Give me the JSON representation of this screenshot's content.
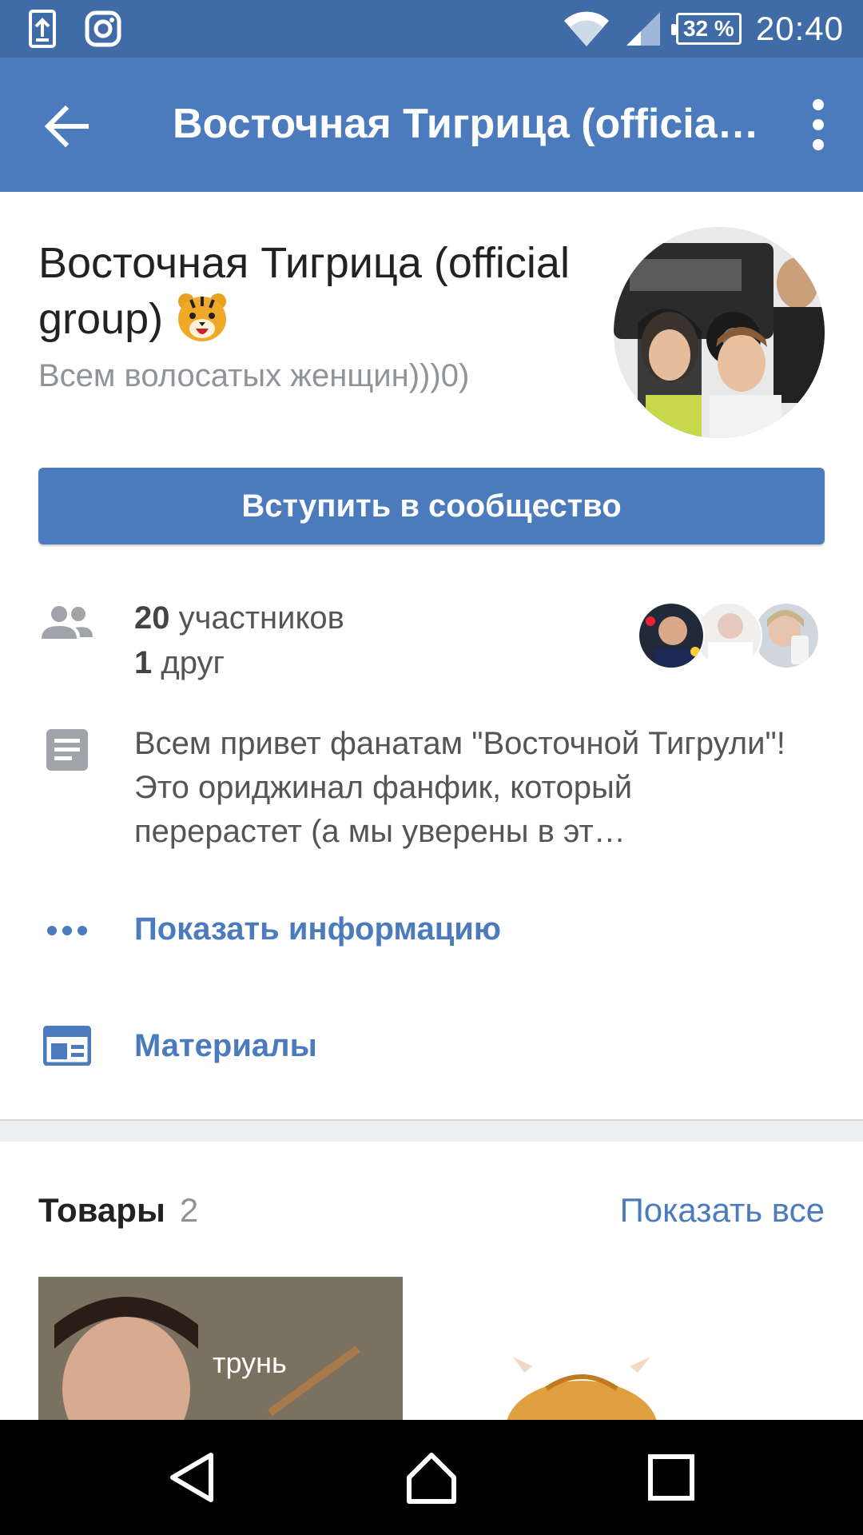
{
  "status_bar": {
    "battery": "32 %",
    "time": "20:40",
    "icons": [
      "upload-icon",
      "instagram-icon",
      "wifi-icon",
      "signal-icon",
      "battery-icon"
    ]
  },
  "app_bar": {
    "title": "Восточная Тигрица (official …"
  },
  "group": {
    "name": "Восточная Тигрица (official group)",
    "status": "Всем волосатых женщин)))0)",
    "join_label": "Вступить в сообщество",
    "members_count": "20",
    "members_label": "участников",
    "friends_count": "1",
    "friends_label": "друг",
    "description": "Всем привет фанатам \"Восточной Тигрули\"! Это ориджинал фанфик, который перерастет (а мы уверены в эт…",
    "show_info_label": "Показать информацию",
    "materials_label": "Материалы"
  },
  "goods": {
    "title": "Товары",
    "count": "2",
    "show_all_label": "Показать все",
    "item1_caption": "трунь"
  },
  "colors": {
    "status_bar": "#3f6ba6",
    "app_bar": "#4b7bbd",
    "accent": "#4b7bbd",
    "secondary_text": "#909499"
  }
}
